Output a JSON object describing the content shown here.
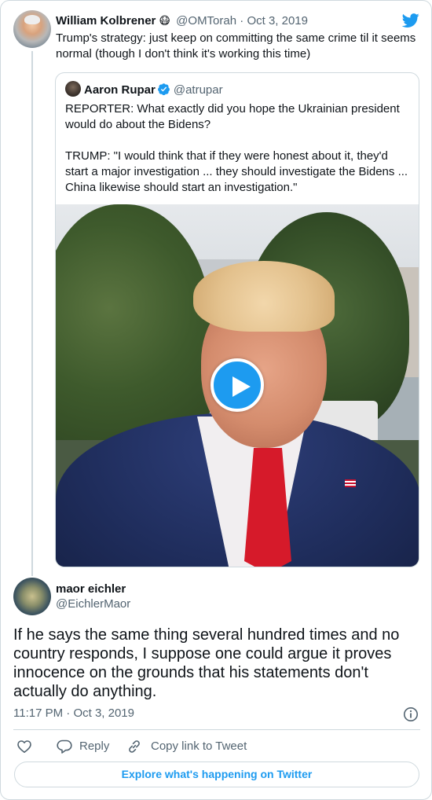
{
  "parent_tweet": {
    "author_name": "William Kolbrener",
    "emoji": "😷",
    "handle": "@OMTorah",
    "separator": "·",
    "date": "Oct 3, 2019",
    "text": "Trump's strategy: just keep on committing the same crime til it seems normal (though I don't think it's working this time)"
  },
  "quoted_tweet": {
    "author_name": "Aaron Rupar",
    "verified": true,
    "handle": "@atrupar",
    "text": "REPORTER: What exactly did you hope the Ukrainian president would do about the Bidens?\n\nTRUMP: \"I would think that if they were honest about it, they'd start a major investigation ... they should investigate the Bidens ... China likewise should start an investigation.\"",
    "media": {
      "type": "video",
      "play_icon": "play-icon"
    }
  },
  "reply_tweet": {
    "author_name": "maor eichler",
    "handle": "@EichlerMaor",
    "text": "If he says the same thing several hundred times and no country responds, I suppose one could argue it proves innocence on the grounds that his statements don't actually do anything.",
    "time": "11:17 PM",
    "separator": "·",
    "date": "Oct 3, 2019"
  },
  "actions": {
    "like_icon": "heart-icon",
    "reply_label": "Reply",
    "copy_label": "Copy link to Tweet"
  },
  "footer": {
    "explore_label": "Explore what's happening on Twitter"
  },
  "colors": {
    "accent": "#1d9bf0",
    "text_primary": "#0f1419",
    "text_secondary": "#536471",
    "border": "#cfd9de"
  }
}
